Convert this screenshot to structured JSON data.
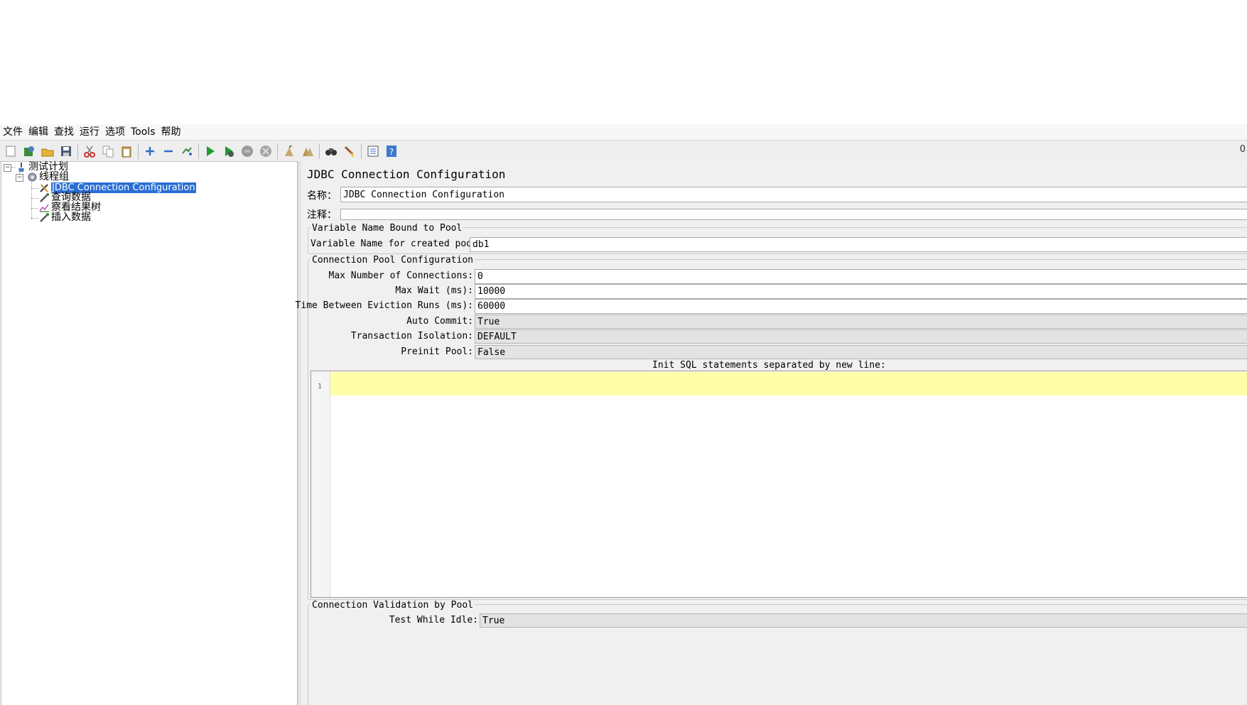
{
  "menu": [
    "文件",
    "编辑",
    "查找",
    "运行",
    "选项",
    "Tools",
    "帮助"
  ],
  "toolbar": {
    "icons": [
      "new-icon",
      "templates-icon",
      "open-icon",
      "save-icon",
      "cut-icon",
      "copy-icon",
      "paste-icon",
      "expand-icon",
      "collapse-icon",
      "toggle-icon",
      "start-icon",
      "start-no-pause-icon",
      "stop-icon",
      "shutdown-icon",
      "clear-icon",
      "clear-all-icon",
      "search-icon",
      "reset-search-icon",
      "function-helper-icon",
      "help-icon"
    ],
    "right_text": "0"
  },
  "tree": {
    "nodes": [
      {
        "label": "测试计划",
        "icon": "test-plan-icon"
      },
      {
        "label": "线程组",
        "icon": "thread-group-icon"
      },
      {
        "label": "JDBC Connection Configuration",
        "icon": "config-element-icon",
        "selected": true
      },
      {
        "label": "查询数据",
        "icon": "sampler-icon"
      },
      {
        "label": "察看结果树",
        "icon": "listener-icon"
      },
      {
        "label": "插入数据",
        "icon": "sampler-icon"
      }
    ]
  },
  "panel": {
    "title": "JDBC Connection Configuration",
    "name_label": "名称：",
    "name_value": "JDBC Connection Configuration",
    "comment_label": "注释：",
    "comment_value": "",
    "var_group": {
      "legend": "Variable Name Bound to Pool",
      "label": "Variable Name for created pool:",
      "value": "db1"
    },
    "pool_group": {
      "legend": "Connection Pool Configuration",
      "max_conn_label": "Max Number of Connections:",
      "max_conn_value": "0",
      "max_wait_label": "Max Wait (ms):",
      "max_wait_value": "10000",
      "eviction_label": "Time Between Eviction Runs (ms):",
      "eviction_value": "60000",
      "auto_commit_label": "Auto Commit:",
      "auto_commit_value": "True",
      "isolation_label": "Transaction Isolation:",
      "isolation_value": "DEFAULT",
      "preinit_label": "Preinit Pool:",
      "preinit_value": "False",
      "init_sql_label": "Init SQL statements separated by new line:",
      "line_number": "1"
    },
    "validation_group": {
      "legend": "Connection Validation by Pool",
      "test_idle_label": "Test While Idle:",
      "test_idle_value": "True"
    }
  }
}
